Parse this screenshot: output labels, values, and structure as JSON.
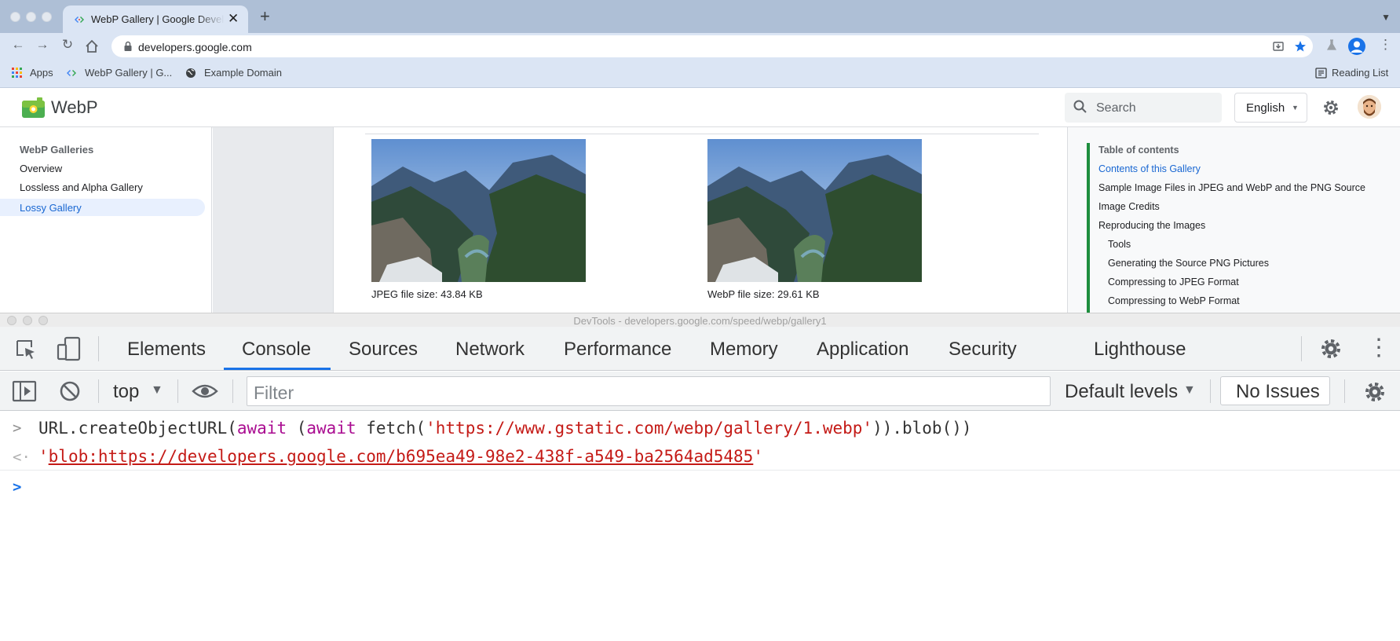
{
  "browser": {
    "tab_title": "WebP Gallery  |  Google Developers",
    "url": "developers.google.com",
    "bookmarks": [
      "Apps",
      "WebP Gallery  |  G...",
      "Example Domain"
    ],
    "reading_list": "Reading List",
    "icons": [
      "back-icon",
      "forward-icon",
      "reload-icon",
      "home-icon",
      "lock-icon",
      "install-icon",
      "star-icon",
      "labs-icon",
      "profile-icon",
      "menu-icon"
    ]
  },
  "site": {
    "brand": "WebP",
    "search_placeholder": "Search",
    "language": "English",
    "leftnav": {
      "heading": "WebP Galleries",
      "items": [
        "Overview",
        "Lossless and Alpha Gallery"
      ],
      "active": "Lossy Gallery"
    },
    "article": {
      "jpeg_caption": "JPEG file size: 43.84 KB",
      "webp_caption": "WebP file size: 29.61 KB"
    },
    "toc": {
      "heading": "Table of contents",
      "active": "Contents of this Gallery",
      "items": [
        "Sample Image Files in JPEG and WebP and the PNG Source",
        "Image Credits",
        "Reproducing the Images"
      ],
      "subitems": [
        "Tools",
        "Generating the Source PNG Pictures",
        "Compressing to JPEG Format",
        "Compressing to WebP Format"
      ]
    }
  },
  "devtools": {
    "title": "DevTools - developers.google.com/speed/webp/gallery1",
    "tabs": [
      "Elements",
      "Console",
      "Sources",
      "Network",
      "Performance",
      "Memory",
      "Application",
      "Security",
      "Lighthouse"
    ],
    "active_tab": "Console",
    "context": "top",
    "filter_placeholder": "Filter",
    "levels": "Default levels",
    "issues": "No Issues",
    "console": {
      "input": {
        "p1": "URL.createObjectURL(",
        "kw1": "await",
        "p2": " (",
        "kw2": "await",
        "p3": " fetch(",
        "str": "'https://www.gstatic.com/webp/gallery/1.webp'",
        "p4": ")).blob())"
      },
      "output": {
        "q1": "'",
        "url": "blob:https://developers.google.com/b695ea49-98e2-438f-a549-ba2564ad5485",
        "q2": "'"
      }
    }
  },
  "colors": {
    "accent": "#1a73e8",
    "toc_bar": "#1e8e3e",
    "keyword": "#aa0d91",
    "string": "#c41a16"
  }
}
